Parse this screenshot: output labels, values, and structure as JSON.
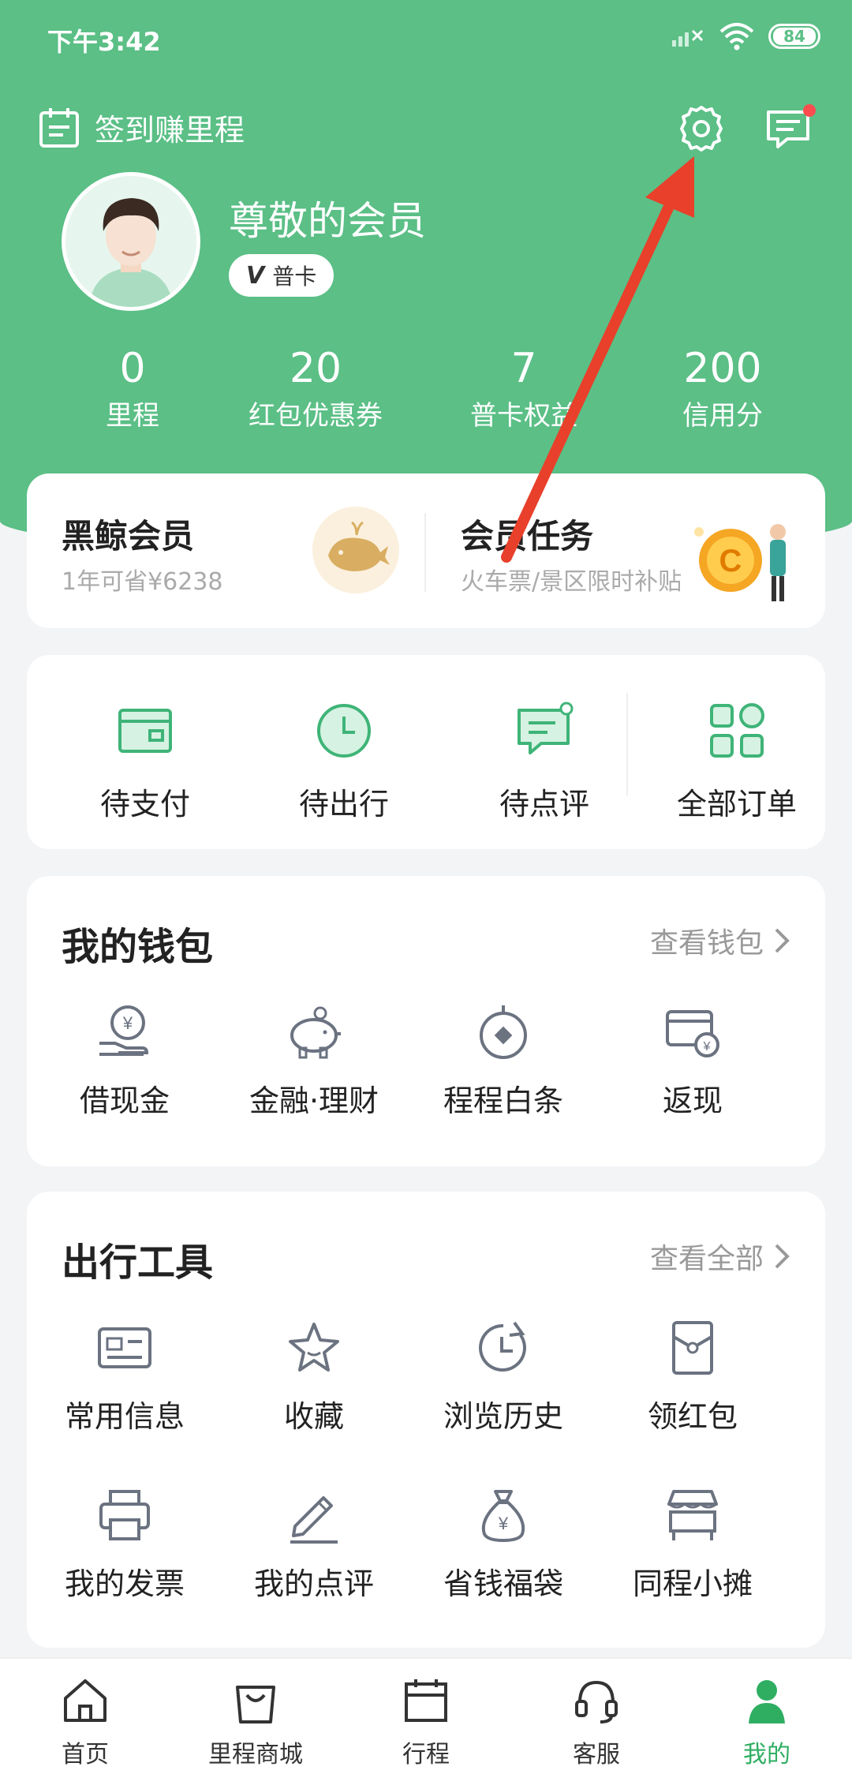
{
  "status_bar": {
    "time": "下午3:42",
    "battery": "84"
  },
  "header": {
    "checkin_label": "签到赚里程",
    "member_name": "尊敬的会员",
    "card_level": "普卡",
    "card_level_mark": "V"
  },
  "stats": [
    {
      "value": "0",
      "label": "里程"
    },
    {
      "value": "20",
      "label": "红包优惠券"
    },
    {
      "value": "7",
      "label": "普卡权益"
    },
    {
      "value": "200",
      "label": "信用分"
    }
  ],
  "member_card": {
    "left": {
      "title": "黑鲸会员",
      "subtitle": "1年可省¥6238"
    },
    "right": {
      "title": "会员任务",
      "subtitle": "火车票/景区限时补贴"
    }
  },
  "orders": [
    {
      "label": "待支付",
      "icon": "wallet-icon"
    },
    {
      "label": "待出行",
      "icon": "clock-icon"
    },
    {
      "label": "待点评",
      "icon": "comment-icon"
    },
    {
      "label": "全部订单",
      "icon": "grid-icon"
    }
  ],
  "wallet": {
    "title": "我的钱包",
    "more": "查看钱包",
    "items": [
      {
        "label": "借现金",
        "icon": "cash-hand-icon"
      },
      {
        "label": "金融·理财",
        "icon": "piggy-bank-icon"
      },
      {
        "label": "程程白条",
        "icon": "credit-icon"
      },
      {
        "label": "返现",
        "icon": "cashback-card-icon"
      }
    ]
  },
  "tools": {
    "title": "出行工具",
    "more": "查看全部",
    "items": [
      {
        "label": "常用信息",
        "icon": "id-card-icon"
      },
      {
        "label": "收藏",
        "icon": "star-icon"
      },
      {
        "label": "浏览历史",
        "icon": "history-icon"
      },
      {
        "label": "领红包",
        "icon": "red-envelope-icon"
      },
      {
        "label": "我的发票",
        "icon": "printer-icon"
      },
      {
        "label": "我的点评",
        "icon": "pen-icon"
      },
      {
        "label": "省钱福袋",
        "icon": "money-bag-icon"
      },
      {
        "label": "同程小摊",
        "icon": "stall-icon"
      }
    ]
  },
  "bottom_nav": [
    {
      "label": "首页",
      "icon": "home-icon"
    },
    {
      "label": "里程商城",
      "icon": "shopping-bag-icon"
    },
    {
      "label": "行程",
      "icon": "calendar-icon"
    },
    {
      "label": "客服",
      "icon": "headset-icon"
    },
    {
      "label": "我的",
      "icon": "user-icon",
      "active": true
    }
  ],
  "colors": {
    "brand_green": "#5bbf86",
    "active_green": "#2fae62",
    "icon_gray": "#6b7280",
    "annotation_red": "#e8402a"
  }
}
